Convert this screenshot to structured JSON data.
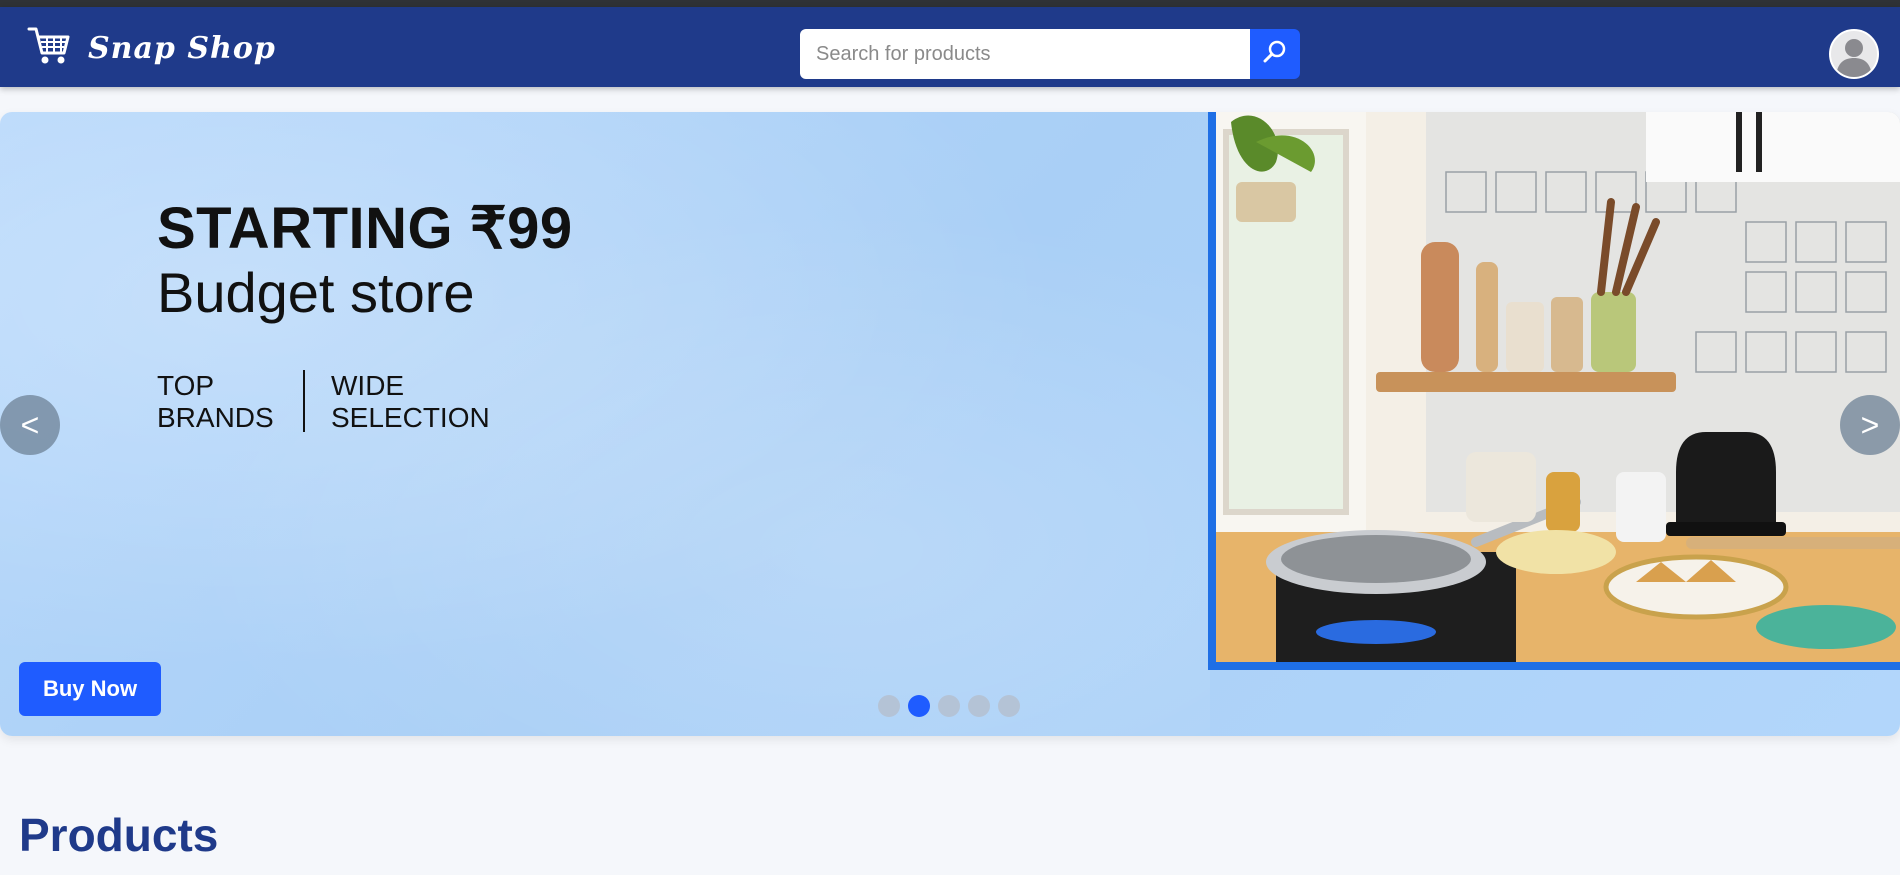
{
  "header": {
    "brand_name": "Snap Shop",
    "brand_icon": "shopping-cart-icon",
    "search": {
      "placeholder": "Search for products",
      "value": "",
      "button_icon": "search-icon"
    },
    "profile_icon": "user-avatar-icon"
  },
  "carousel": {
    "headline": "STARTING ₹99",
    "subheadline": "Budget store",
    "tag_left": "TOP BRANDS",
    "tag_right": "WIDE SELECTION",
    "buy_label": "Buy Now",
    "prev_label": "<",
    "next_label": ">",
    "slide_count": 5,
    "active_slide": 2
  },
  "main": {
    "section_title": "Products"
  },
  "colors": {
    "navbar": "#1f3a8a",
    "accent": "#1f5cff",
    "banner_bg": "#b2d6fb",
    "title": "#1f3a8a"
  }
}
